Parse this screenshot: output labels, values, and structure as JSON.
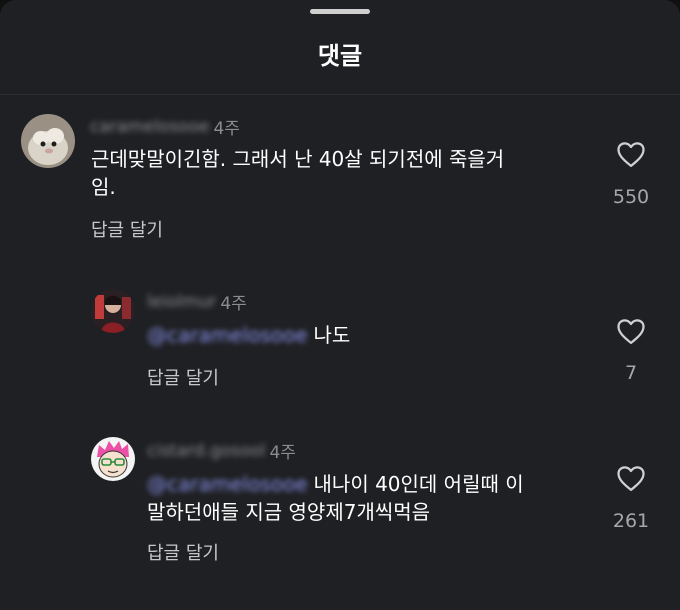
{
  "title": "댓글",
  "reply_label": "답글 달기",
  "comments": [
    {
      "username": "caramelosooe",
      "time": "4주",
      "text": "근데맞말이긴함. 그래서 난 40살 되기전에 죽을거\n임.",
      "likes": "550"
    },
    {
      "username": "leiolmur",
      "time": "4주",
      "mention": "@caramelosooe",
      "text": "나도",
      "likes": "7"
    },
    {
      "username": "cistard.gosool",
      "time": "4주",
      "mention": "@caramelosooe",
      "text": "내나이 40인데 어릴때 이\n말하던애들 지금 영양제7개씩먹음",
      "likes": "261"
    }
  ],
  "colors": {
    "background": "#1f2023",
    "text": "#ffffff",
    "muted": "#8b8c90",
    "mention": "#8a93ee"
  },
  "icons": {
    "like": "heart-outline-icon"
  }
}
